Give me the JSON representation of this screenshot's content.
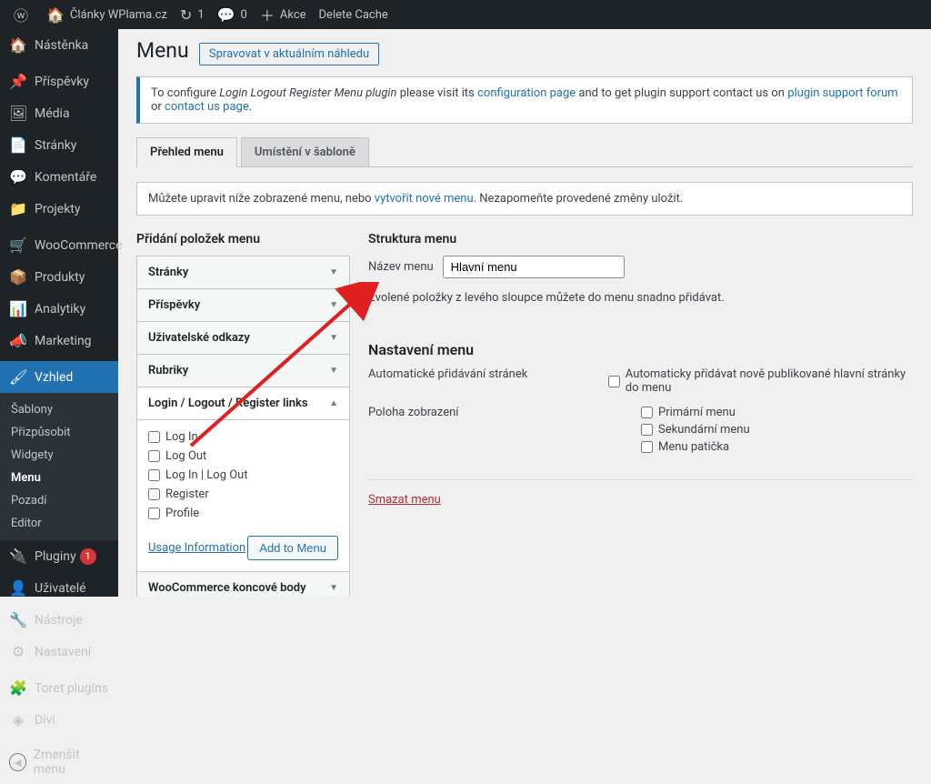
{
  "adminbar": {
    "site_name": "Články WPlama.cz",
    "updates_count": "1",
    "comments_count": "0",
    "new_label": "Akce",
    "delete_cache": "Delete Cache"
  },
  "sidebar": {
    "items": [
      {
        "icon": "🏠",
        "label": "Nástěnka"
      },
      {
        "icon": "📌",
        "label": "Příspěvky"
      },
      {
        "icon": "🖼",
        "label": "Média"
      },
      {
        "icon": "📄",
        "label": "Stránky"
      },
      {
        "icon": "💬",
        "label": "Komentáře"
      },
      {
        "icon": "📁",
        "label": "Projekty"
      }
    ],
    "items2": [
      {
        "icon": "🛒",
        "label": "WooCommerce"
      },
      {
        "icon": "📦",
        "label": "Produkty"
      },
      {
        "icon": "📊",
        "label": "Analytiky"
      },
      {
        "icon": "📣",
        "label": "Marketing"
      }
    ],
    "appearance": {
      "icon": "🖌",
      "label": "Vzhled"
    },
    "submenu": [
      "Šablony",
      "Přizpůsobit",
      "Widgety",
      "Menu",
      "Pozadí",
      "Editor"
    ],
    "items3": [
      {
        "icon": "🔌",
        "label": "Pluginy",
        "badge": "1"
      },
      {
        "icon": "👤",
        "label": "Uživatelé"
      },
      {
        "icon": "🔧",
        "label": "Nástroje"
      },
      {
        "icon": "⚙",
        "label": "Nastavení"
      }
    ],
    "items4": [
      {
        "icon": "🧩",
        "label": "Toret plugins"
      },
      {
        "icon": "◈",
        "label": "Divi"
      }
    ],
    "collapse": "Zmenšit menu"
  },
  "page": {
    "title": "Menu",
    "manage_preview": "Spravovat v aktuálním náhledu",
    "notice_pre": "To configure ",
    "notice_plugin": "Login Logout Register Menu plugin",
    "notice_mid1": " please visit its ",
    "notice_link1": "configuration page",
    "notice_mid2": " and to get plugin support contact us on ",
    "notice_link2": "plugin support forum",
    "notice_mid3": " or ",
    "notice_link3": "contact us page",
    "notice_end": ".",
    "tabs": {
      "overview": "Přehled menu",
      "locations": "Umístění v šabloně"
    },
    "edit_hint_pre": "Můžete upravit níže zobrazené menu, nebo ",
    "edit_hint_link": "vytvořit nové menu",
    "edit_hint_post": ". Nezapomeňte provedené změny uložit."
  },
  "left": {
    "heading": "Přidání položek menu",
    "panels": {
      "pages": "Stránky",
      "posts": "Příspěvky",
      "links": "Uživatelské odkazy",
      "cats": "Rubriky",
      "llr": "Login / Logout / Register links",
      "woo": "WooCommerce koncové body"
    },
    "llr_items": [
      "Log In",
      "Log Out",
      "Log In | Log Out",
      "Register",
      "Profile"
    ],
    "usage_info": "Usage Information",
    "add_to_menu": "Add to Menu"
  },
  "right": {
    "heading": "Struktura menu",
    "name_label": "Název menu",
    "name_value": "Hlavní menu",
    "drag_hint": "Zvolené položky z levého sloupce můžete do menu snadno přidávat.",
    "settings_heading": "Nastavení menu",
    "auto_add_label": "Automatické přidávání stránek",
    "auto_add_option": "Automaticky přidávat nově publikované hlavní stránky do menu",
    "location_label": "Poloha zobrazení",
    "locations": [
      "Primární menu",
      "Sekundární menu",
      "Menu patička"
    ],
    "delete": "Smazat menu"
  }
}
